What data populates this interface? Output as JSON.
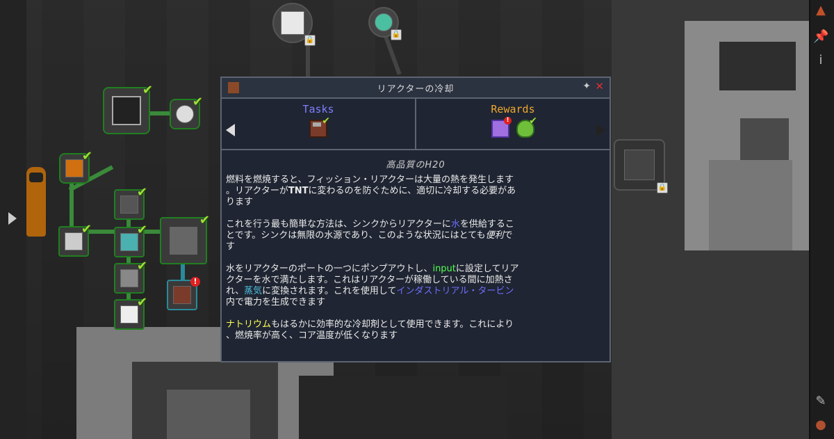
{
  "dialog": {
    "title": "リアクターの冷却",
    "tasks_label": "Tasks",
    "rewards_label": "Rewards",
    "subtitle": "高品質のH20",
    "paragraphs": [
      [
        {
          "t": "燃料を燃焼すると、フィッション・リアクターは大量の熱を発生します\n。リアクターが"
        },
        {
          "t": "TNT",
          "style": "bold"
        },
        {
          "t": "に変わるのを防ぐために、適切に冷却する必要があ\nります"
        }
      ],
      [
        {
          "t": "これを行う最も簡単な方法は、シンクからリアクターに"
        },
        {
          "t": "水",
          "style": "blue"
        },
        {
          "t": "を供給するこ\nとです。シンクは無限の水源であり、このような状況にはとても"
        },
        {
          "t": "便利",
          "style": "ital"
        },
        {
          "t": "で\nす"
        }
      ],
      [
        {
          "t": "水をリアクターのポートの一つにポンプアウトし、"
        },
        {
          "t": "input",
          "style": "green"
        },
        {
          "t": "に設定してリア\nクターを水で満たします。これはリアクターが稼働している間に加熱さ\nれ、"
        },
        {
          "t": "蒸気",
          "style": "lblue"
        },
        {
          "t": "に変換されます。これを使用して"
        },
        {
          "t": "インダストリアル・タービン",
          "style": "blue"
        },
        {
          "t": "\n内で電力を生成できます"
        }
      ],
      [
        {
          "t": "ナトリウム",
          "style": "yellow"
        },
        {
          "t": "もはるかに効率的な冷却剤として使用できます。これにより\n、燃焼率が高く、コア温度が低くなります"
        }
      ]
    ]
  },
  "icons": {
    "task_item": "fission-reactor-port-icon",
    "reward_crate": "loot-crate-icon",
    "reward_bag": "loot-bag-icon",
    "pin": "pin-icon",
    "close": "close-icon"
  },
  "colors": {
    "dialog_bg": "#1f2532",
    "border": "#5d6472",
    "tasks": "#7f7fff",
    "rewards": "#f0a830",
    "completed": "#9ee03a",
    "link_blue": "#6e6eff",
    "input_green": "#55ff55",
    "sodium_yellow": "#ffff55"
  }
}
